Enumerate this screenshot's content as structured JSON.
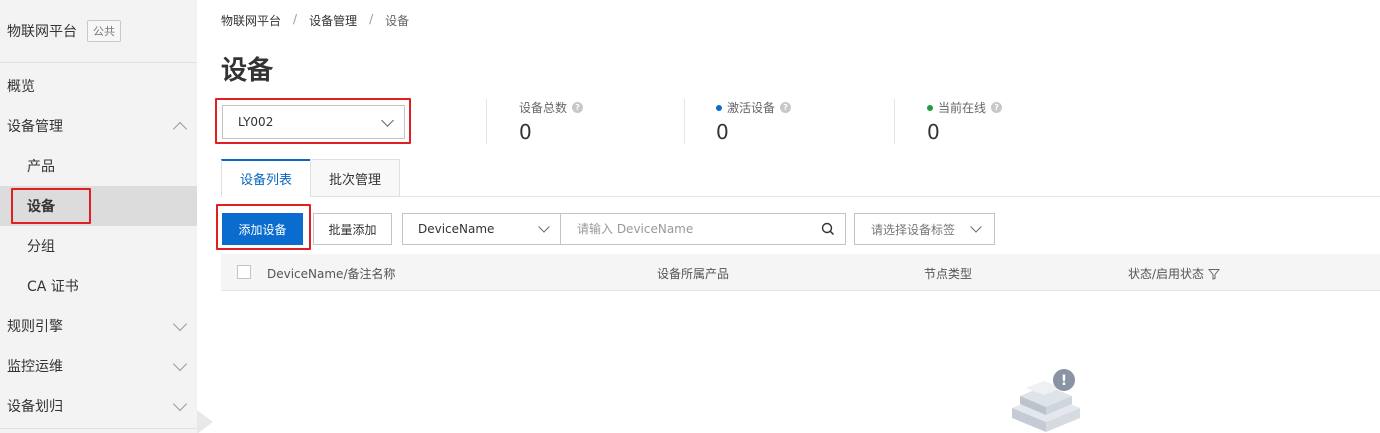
{
  "sidebar": {
    "title": "物联网平台",
    "badge": "公共",
    "items": [
      {
        "label": "概览"
      },
      {
        "label": "设备管理"
      },
      {
        "label": "产品"
      },
      {
        "label": "设备"
      },
      {
        "label": "分组"
      },
      {
        "label": "CA 证书"
      },
      {
        "label": "规则引擎"
      },
      {
        "label": "监控运维"
      },
      {
        "label": "设备划归"
      }
    ]
  },
  "breadcrumb": [
    "物联网平台",
    "设备管理",
    "设备"
  ],
  "breadcrumb_sep": "/",
  "page_title": "设备",
  "product_select": {
    "value": "LY002"
  },
  "stats": [
    {
      "label": "设备总数",
      "value": "0"
    },
    {
      "label": "激活设备",
      "value": "0",
      "dot_color": "#0a6ccf"
    },
    {
      "label": "当前在线",
      "value": "0",
      "dot_color": "#1e9e3a"
    }
  ],
  "help_glyph": "?",
  "tabs": [
    {
      "label": "设备列表",
      "active": true
    },
    {
      "label": "批次管理",
      "active": false
    }
  ],
  "toolbar": {
    "add_label": "添加设备",
    "batch_add_label": "批量添加",
    "field_value": "DeviceName",
    "search_placeholder": "请输入 DeviceName",
    "tag_placeholder": "请选择设备标签"
  },
  "table": {
    "columns": [
      "DeviceName/备注名称",
      "设备所属产品",
      "节点类型",
      "状态/启用状态"
    ]
  },
  "empty_glyph": "!",
  "colors": {
    "primary": "#0a6ccf",
    "active_tab": "#0a67c2",
    "highlight_box": "#e02020"
  },
  "icons": {
    "search": "search-icon",
    "filter": "filter-icon",
    "empty": "empty-state-icon"
  }
}
